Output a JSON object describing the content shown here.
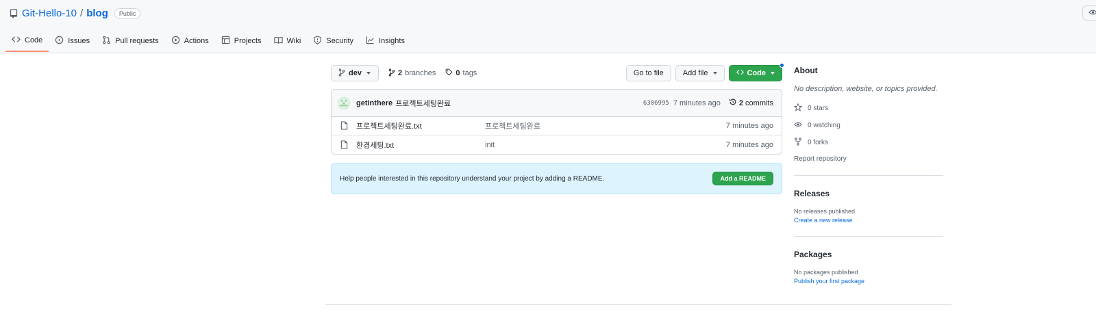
{
  "repo": {
    "owner": "Git-Hello-10",
    "separator": "/",
    "name": "blog",
    "visibility": "Public"
  },
  "tabs": [
    {
      "label": "Code",
      "icon": "code-icon",
      "active": true
    },
    {
      "label": "Issues",
      "icon": "issue-icon"
    },
    {
      "label": "Pull requests",
      "icon": "pull-request-icon"
    },
    {
      "label": "Actions",
      "icon": "play-icon"
    },
    {
      "label": "Projects",
      "icon": "table-icon"
    },
    {
      "label": "Wiki",
      "icon": "book-icon"
    },
    {
      "label": "Security",
      "icon": "shield-icon"
    },
    {
      "label": "Insights",
      "icon": "graph-icon"
    }
  ],
  "toolbar": {
    "branch": "dev",
    "branches_count": "2",
    "branches_label": "branches",
    "tags_count": "0",
    "tags_label": "tags",
    "go_to_file": "Go to file",
    "add_file": "Add file",
    "code": "Code"
  },
  "commit": {
    "author": "getinthere",
    "message": "프로젝트세팅완료",
    "sha": "6306995",
    "time": "7 minutes ago",
    "commits_count": "2",
    "commits_label": "commits"
  },
  "files": [
    {
      "name": "프로젝트세팅완료.txt",
      "message": "프로젝트세팅완료",
      "time": "7 minutes ago"
    },
    {
      "name": "환경세팅.txt",
      "message": "init",
      "time": "7 minutes ago"
    }
  ],
  "readme": {
    "text": "Help people interested in this repository understand your project by adding a README.",
    "button": "Add a README"
  },
  "about": {
    "heading": "About",
    "description": "No description, website, or topics provided.",
    "stars": "0 stars",
    "watching": "0 watching",
    "forks": "0 forks",
    "report": "Report repository"
  },
  "releases": {
    "heading": "Releases",
    "empty": "No releases published",
    "link": "Create a new release"
  },
  "packages": {
    "heading": "Packages",
    "empty": "No packages published",
    "link": "Publish your first package"
  },
  "colors": {
    "accent": "#0969da",
    "green": "#2da44e",
    "tab_underline": "#fd8c73",
    "readme_bg": "#ddf4ff"
  }
}
